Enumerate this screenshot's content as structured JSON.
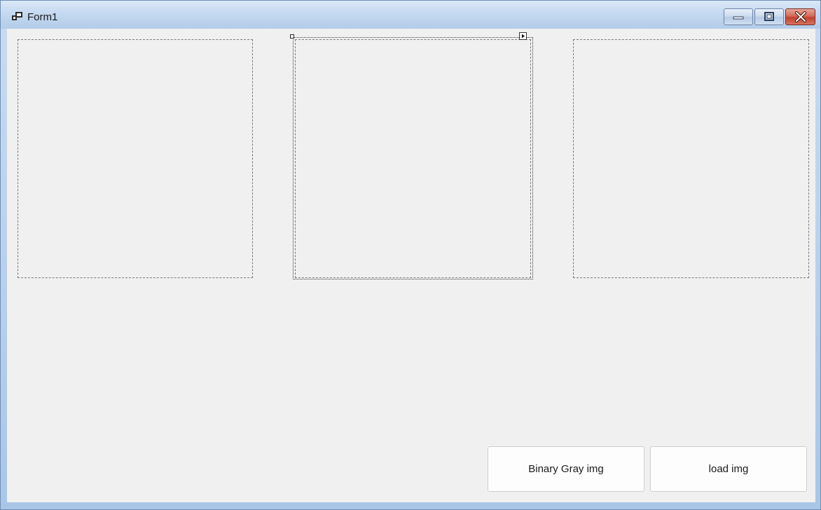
{
  "window": {
    "title": "Form1",
    "icons": {
      "app": "form-window-icon",
      "minimize": "minimize-icon",
      "maximize": "maximize-icon",
      "close": "close-icon"
    }
  },
  "designer": {
    "picture_boxes": [
      "pictureBox1",
      "pictureBox2",
      "pictureBox3"
    ],
    "selected": "pictureBox2",
    "smart_tag_icon": "smart-tag-arrow-icon"
  },
  "buttons": {
    "binary_gray": "Binary Gray img",
    "load": "load img"
  },
  "colors": {
    "form_background": "#f0f0f0",
    "titlebar": "#c5d9f1",
    "close_button": "#c2412f"
  }
}
